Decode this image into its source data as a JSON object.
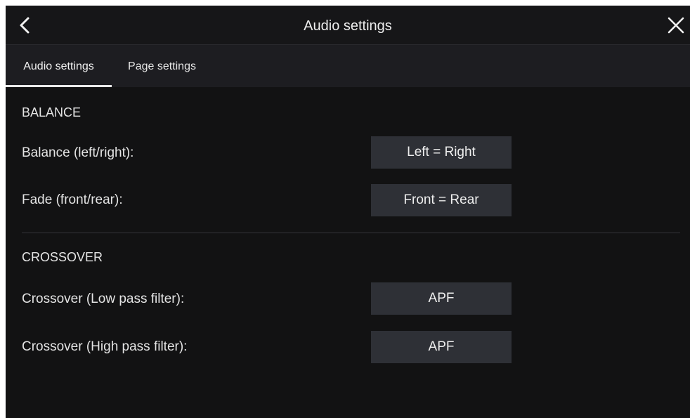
{
  "header": {
    "title": "Audio settings",
    "back_icon": "chevron-left-icon",
    "close_icon": "close-icon"
  },
  "tabs": [
    {
      "label": "Audio settings",
      "active": true
    },
    {
      "label": "Page settings",
      "active": false
    }
  ],
  "sections": {
    "balance": {
      "heading": "BALANCE",
      "rows": [
        {
          "label": "Balance (left/right):",
          "value": "Left = Right"
        },
        {
          "label": "Fade (front/rear):",
          "value": "Front = Rear"
        }
      ]
    },
    "crossover": {
      "heading": "CROSSOVER",
      "rows": [
        {
          "label": "Crossover (Low pass filter):",
          "value": "APF"
        },
        {
          "label": "Crossover (High pass filter):",
          "value": "APF"
        }
      ]
    }
  },
  "colors": {
    "background": "#121213",
    "header": "#161618",
    "tabbar": "#1d1d21",
    "button": "#2e3036",
    "text": "#e4e4e4",
    "tab_indicator": "#e9e9e9"
  }
}
